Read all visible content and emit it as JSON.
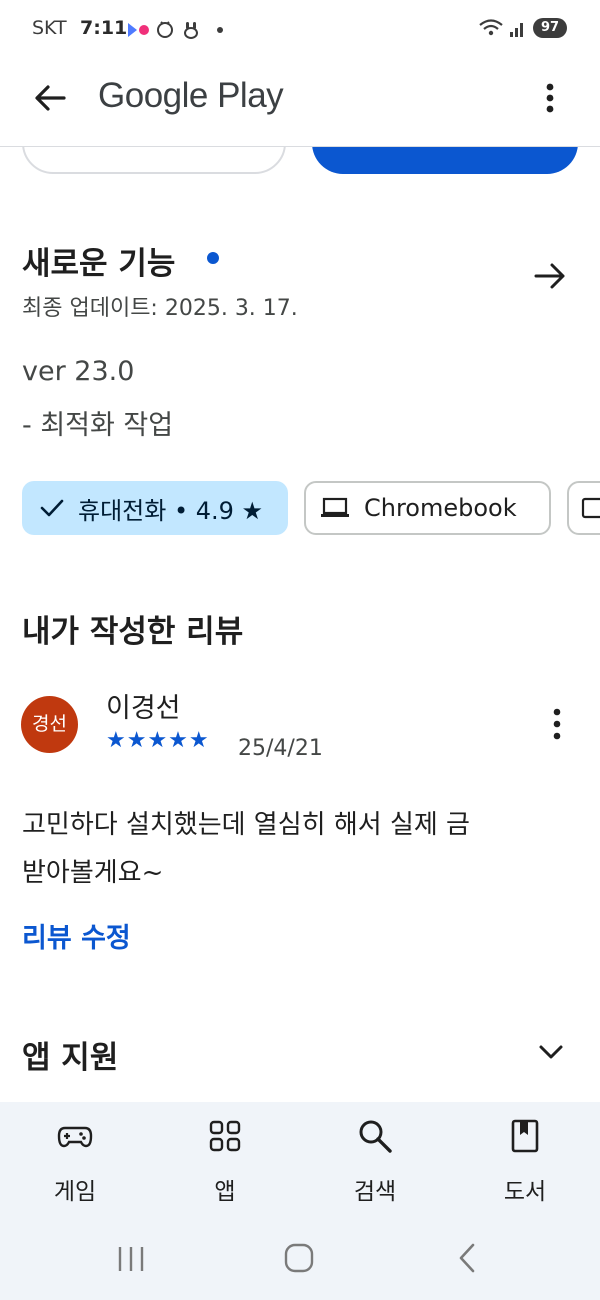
{
  "status_bar": {
    "carrier": "SKT",
    "time": "7:11",
    "battery": "97"
  },
  "app_bar": {
    "title": "Google Play"
  },
  "whats_new": {
    "title": "새로운 기능",
    "updated": "최종 업데이트: 2025. 3. 17.",
    "version": "ver 23.0",
    "note": "- 최적화 작업"
  },
  "device_chips": [
    {
      "label": "휴대전화 • 4.9 ★",
      "selected": true,
      "icon": "check-icon"
    },
    {
      "label": "Chromebook",
      "selected": false,
      "icon": "laptop-icon"
    },
    {
      "label": "",
      "selected": false,
      "icon": "tablet-icon"
    }
  ],
  "my_review": {
    "section_title": "내가 작성한 리뷰",
    "avatar_text": "경선",
    "author": "이경선",
    "stars": "★★★★★",
    "rating": 5,
    "date": "25/4/21",
    "text_line1": "고민하다 설치했는데 열심히 해서 실제 금",
    "text_line2": "받아볼게요~",
    "edit_link": "리뷰 수정"
  },
  "app_support": {
    "title": "앱 지원"
  },
  "bottom_nav": [
    {
      "label": "게임",
      "icon": "gamepad-icon"
    },
    {
      "label": "앱",
      "icon": "apps-grid-icon"
    },
    {
      "label": "검색",
      "icon": "search-icon"
    },
    {
      "label": "도서",
      "icon": "book-icon"
    }
  ],
  "colors": {
    "accent": "#0b57d0",
    "chip_selected_bg": "#c2e7ff",
    "avatar_bg": "#c0390f",
    "nav_bg": "#f0f4f9"
  }
}
